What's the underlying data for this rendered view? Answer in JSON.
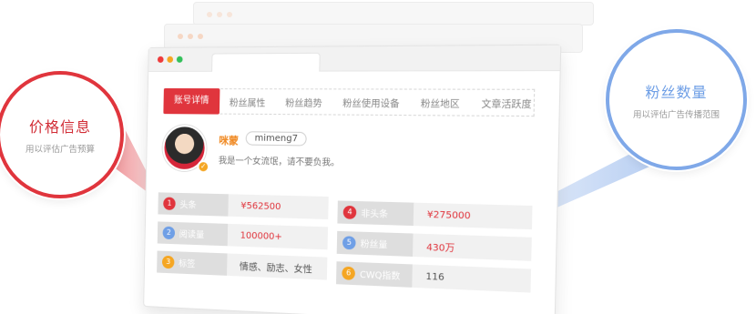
{
  "tabs": [
    "账号详情",
    "粉丝属性",
    "粉丝趋势",
    "粉丝使用设备",
    "粉丝地区",
    "文章活跃度"
  ],
  "profile": {
    "nickname": "咪蒙",
    "handle": "mimeng7",
    "bio": "我是一个女流氓，请不要负我。"
  },
  "stats": [
    {
      "num": "1",
      "label": "头条",
      "value": "¥562500",
      "color": "#e0353d",
      "value_style": "red"
    },
    {
      "num": "4",
      "label": "非头条",
      "value": "¥275000",
      "color": "#e0353d",
      "value_style": "red"
    },
    {
      "num": "2",
      "label": "阅读量",
      "value": "100000+",
      "color": "#6f9fe6",
      "value_style": "red"
    },
    {
      "num": "5",
      "label": "粉丝量",
      "value": "430万",
      "color": "#6f9fe6",
      "value_style": "red"
    },
    {
      "num": "3",
      "label": "标签",
      "value": "情感、励志、女性",
      "color": "#f5a623",
      "value_style": "gray"
    },
    {
      "num": "6",
      "label": "CWQ指数",
      "value": "116",
      "color": "#f5a623",
      "value_style": "gray"
    }
  ],
  "callouts": {
    "left": {
      "title": "价格信息",
      "subtitle": "用以评估广告预算"
    },
    "right": {
      "title": "粉丝数量",
      "subtitle": "用以评估广告传播范围"
    }
  },
  "colors": {
    "accent_red": "#e0353d",
    "accent_blue": "#6f9fe6",
    "accent_orange": "#f5a623"
  }
}
